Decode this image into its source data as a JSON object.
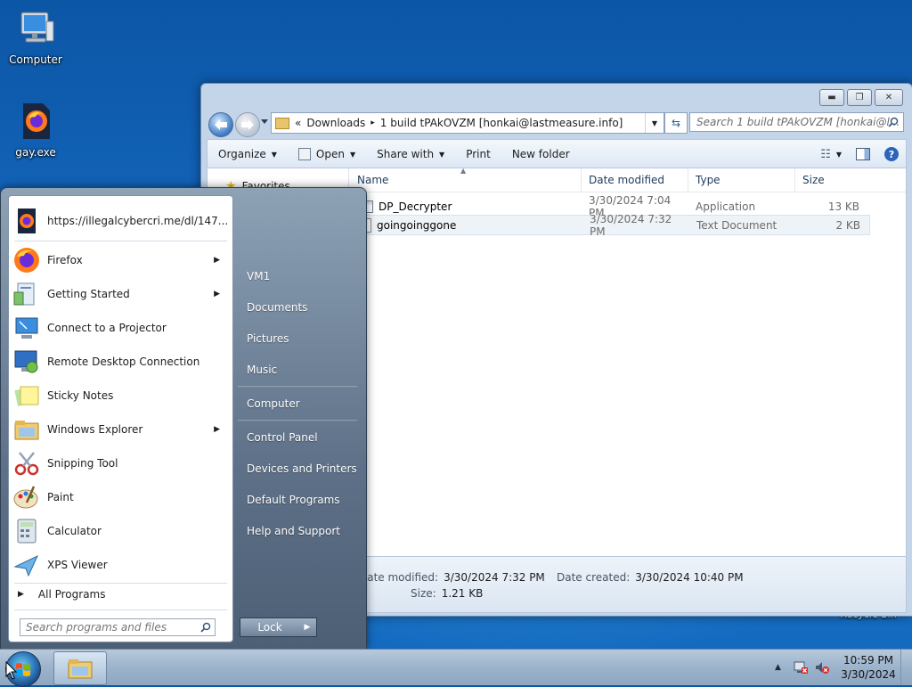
{
  "desktop": {
    "icons": [
      {
        "label": "Computer",
        "icon": "computer-icon"
      },
      {
        "label": "gay.exe",
        "icon": "firefox-icon"
      }
    ],
    "recycle_label": "Recycle Bin"
  },
  "explorer": {
    "address": {
      "overflow": "«",
      "segments": [
        "Downloads",
        "1 build tPAkOVZM [honkai@lastmeasure.info]"
      ],
      "separator": "▸"
    },
    "search_placeholder": "Search 1 build tPAkOVZM [honkai@l...",
    "toolbar": {
      "organize": "Organize",
      "open": "Open",
      "share_with": "Share with",
      "print": "Print",
      "new_folder": "New folder"
    },
    "nav_pane": {
      "favorites": "Favorites"
    },
    "columns": {
      "name": "Name",
      "date": "Date modified",
      "type": "Type",
      "size": "Size"
    },
    "files": [
      {
        "name": "DP_Decrypter",
        "date": "3/30/2024 7:04 PM",
        "type": "Application",
        "size": "13 KB",
        "icon": "application-icon"
      },
      {
        "name": "goingoinggone",
        "date": "3/30/2024 7:32 PM",
        "type": "Text Document",
        "size": "2 KB",
        "icon": "text-document-icon"
      }
    ],
    "details": {
      "modified_label": "Date modified:",
      "modified_value": "3/30/2024 7:32 PM",
      "created_label": "Date created:",
      "created_value": "3/30/2024 10:40 PM",
      "size_label": "Size:",
      "size_value": "1.21 KB"
    }
  },
  "start_menu": {
    "pinned": [
      {
        "label": "https://illegalcybercri.me/dl/147...",
        "icon": "firefox-icon",
        "submenu": false
      }
    ],
    "programs": [
      {
        "label": "Firefox",
        "icon": "firefox-icon",
        "submenu": true
      },
      {
        "label": "Getting Started",
        "icon": "getting-started-icon",
        "submenu": true
      },
      {
        "label": "Connect to a Projector",
        "icon": "projector-icon",
        "submenu": false
      },
      {
        "label": "Remote Desktop Connection",
        "icon": "remote-desktop-icon",
        "submenu": false
      },
      {
        "label": "Sticky Notes",
        "icon": "sticky-notes-icon",
        "submenu": false
      },
      {
        "label": "Windows Explorer",
        "icon": "windows-explorer-icon",
        "submenu": true
      },
      {
        "label": "Snipping Tool",
        "icon": "snipping-tool-icon",
        "submenu": false
      },
      {
        "label": "Paint",
        "icon": "paint-icon",
        "submenu": false
      },
      {
        "label": "Calculator",
        "icon": "calculator-icon",
        "submenu": false
      },
      {
        "label": "XPS Viewer",
        "icon": "xps-viewer-icon",
        "submenu": false
      }
    ],
    "all_programs": "All Programs",
    "search_placeholder": "Search programs and files",
    "right_items": [
      "VM1",
      "Documents",
      "Pictures",
      "Music",
      "Computer",
      "Control Panel",
      "Devices and Printers",
      "Default Programs",
      "Help and Support"
    ],
    "lock_label": "Lock"
  },
  "taskbar": {
    "clock_time": "10:59 PM",
    "clock_date": "3/30/2024"
  }
}
